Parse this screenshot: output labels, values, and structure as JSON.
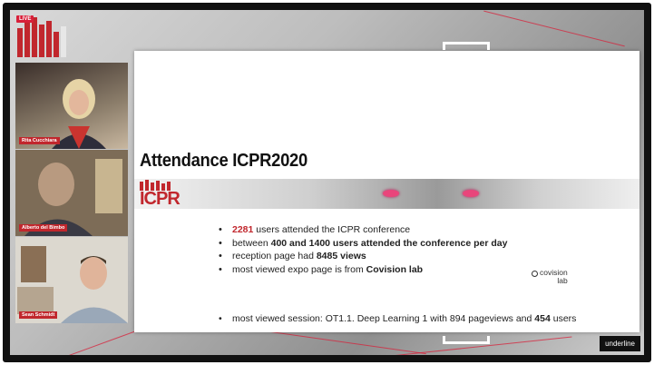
{
  "badge": {
    "live_label": "LIVE"
  },
  "participants": [
    {
      "name": "Rita Cucchiara"
    },
    {
      "name": "Alberto del Bimbo"
    },
    {
      "name": "Sean Schmidt"
    }
  ],
  "slide": {
    "title": "Attendance ICPR2020",
    "logo_text": "ICPR",
    "bullets": [
      {
        "value": "2281",
        "text": " users attended the ICPR conference"
      },
      {
        "pre": "between ",
        "bold": "400 and 1400 users attended the conference per day"
      },
      {
        "pre": "reception page had ",
        "bold": "8485 views"
      },
      {
        "pre": "most viewed expo page is from ",
        "bold": "Covision lab"
      }
    ],
    "covision_logo": {
      "line1": "covision",
      "line2": "lab"
    },
    "session": {
      "pre": "most viewed session: OT1.1. Deep Learning 1  with 894 pageviews and ",
      "bold": "454",
      "post": " users"
    }
  },
  "brand": {
    "label": "underline"
  },
  "colors": {
    "accent": "#c1272d",
    "eye": "#e9457b"
  },
  "icons": [
    "icpr-logo",
    "live-badge",
    "bullet-dot",
    "covision-logo"
  ]
}
